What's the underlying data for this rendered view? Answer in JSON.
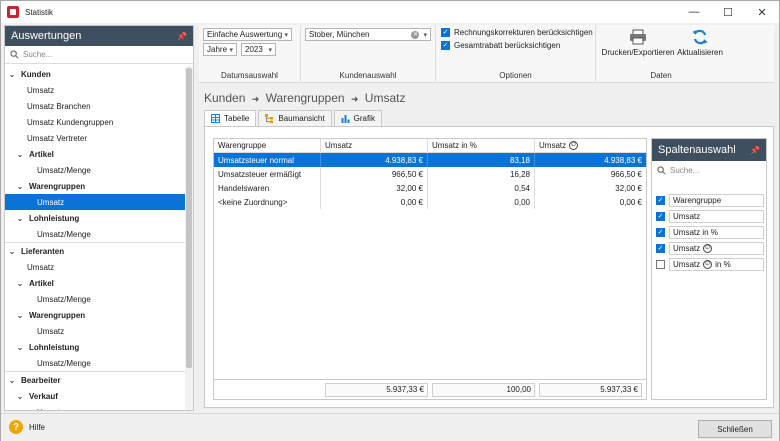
{
  "window": {
    "title": "Statistik",
    "minimize": "—",
    "maximize": "☐",
    "close": "✕"
  },
  "sidebar": {
    "title": "Auswertungen",
    "search_placeholder": "Suche...",
    "items": [
      {
        "label": "Kunden",
        "level": 0,
        "expanded": true
      },
      {
        "label": "Umsatz",
        "level": 1
      },
      {
        "label": "Umsatz Branchen",
        "level": 1
      },
      {
        "label": "Umsatz Kundengruppen",
        "level": 1
      },
      {
        "label": "Umsatz Vertreter",
        "level": 1
      },
      {
        "label": "Artikel",
        "level": 1,
        "expanded": true
      },
      {
        "label": "Umsatz/Menge",
        "level": 2
      },
      {
        "label": "Warengruppen",
        "level": 1,
        "expanded": true
      },
      {
        "label": "Umsatz",
        "level": 2,
        "selected": true
      },
      {
        "label": "Lohnleistung",
        "level": 1,
        "expanded": true
      },
      {
        "label": "Umsatz/Menge",
        "level": 2
      },
      {
        "label": "Lieferanten",
        "level": 0,
        "expanded": true
      },
      {
        "label": "Umsatz",
        "level": 1
      },
      {
        "label": "Artikel",
        "level": 1,
        "expanded": true
      },
      {
        "label": "Umsatz/Menge",
        "level": 2
      },
      {
        "label": "Warengruppen",
        "level": 1,
        "expanded": true
      },
      {
        "label": "Umsatz",
        "level": 2
      },
      {
        "label": "Lohnleistung",
        "level": 1,
        "expanded": true
      },
      {
        "label": "Umsatz/Menge",
        "level": 2
      },
      {
        "label": "Bearbeiter",
        "level": 0,
        "expanded": true
      },
      {
        "label": "Verkauf",
        "level": 1,
        "expanded": true
      },
      {
        "label": "Umsatz",
        "level": 2
      }
    ]
  },
  "ribbon": {
    "datum": {
      "type_value": "Einfache Auswertung",
      "period_value": "Jahre",
      "year_value": "2023",
      "label": "Datumsauswahl"
    },
    "kunde": {
      "value": "Stober, München",
      "label": "Kundenauswahl"
    },
    "optionen": {
      "opt1": "Rechnungskorrekturen berücksichtigen",
      "opt2": "Gesamtrabatt berücksichtigen",
      "label": "Optionen"
    },
    "daten": {
      "print": "Drucken/Exportieren",
      "refresh": "Aktualisieren",
      "label": "Daten"
    }
  },
  "breadcrumb": {
    "p1": "Kunden",
    "p2": "Warengruppen",
    "p3": "Umsatz",
    "sep": "➜"
  },
  "tabs": [
    {
      "label": "Tabelle",
      "active": true
    },
    {
      "label": "Baumansicht"
    },
    {
      "label": "Grafik"
    }
  ],
  "table": {
    "headers": [
      "Warengruppe",
      "Umsatz",
      "Umsatz in %",
      "Umsatz"
    ],
    "rows": [
      {
        "name": "Umsatzsteuer normal",
        "umsatz": "4.938,83 €",
        "pct": "83,18",
        "avg": "4.938,83 €",
        "selected": true
      },
      {
        "name": "Umsatzsteuer ermäßigt",
        "umsatz": "966,50 €",
        "pct": "16,28",
        "avg": "966,50 €"
      },
      {
        "name": "Handelswaren",
        "umsatz": "32,00 €",
        "pct": "0,54",
        "avg": "32,00 €"
      },
      {
        "name": "<keine Zuordnung>",
        "umsatz": "0,00 €",
        "pct": "0,00",
        "avg": "0,00 €"
      }
    ],
    "footer": {
      "umsatz": "5.937,33 €",
      "pct": "100,00",
      "avg": "5.937,33 €"
    }
  },
  "columns_panel": {
    "title": "Spaltenauswahl",
    "search_placeholder": "Suche...",
    "items": [
      {
        "label": "Warengruppe",
        "checked": true
      },
      {
        "label": "Umsatz",
        "checked": true
      },
      {
        "label": "Umsatz in %",
        "checked": true
      },
      {
        "label": "Umsatz",
        "checked": true
      },
      {
        "label": "Umsatz",
        "suffix": "in %",
        "checked": false
      }
    ]
  },
  "statusbar": {
    "help": "Hilfe",
    "close": "Schließen"
  },
  "colors": {
    "accent": "#0a74d6",
    "header_dark": "#3f4f60",
    "app_icon": "#c8262a",
    "help": "#f0a400"
  }
}
